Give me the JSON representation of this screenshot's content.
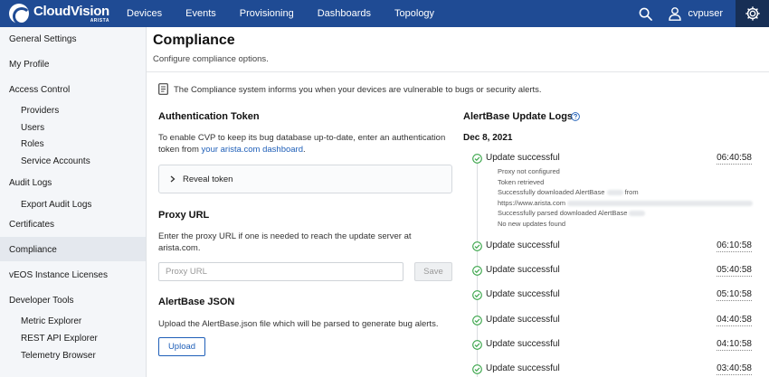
{
  "header": {
    "brand": "CloudVision",
    "brand_sub": "ARISTA",
    "nav": [
      "Devices",
      "Events",
      "Provisioning",
      "Dashboards",
      "Topology"
    ],
    "username": "cvpuser",
    "icons": {
      "search": "search-icon",
      "user": "user-icon",
      "settings": "gear-icon"
    },
    "colors": {
      "bar": "#1f4b94",
      "settings_bg": "#172f55"
    }
  },
  "sidebar": {
    "general_settings": "General Settings",
    "my_profile": "My Profile",
    "access_control": "Access Control",
    "providers": "Providers",
    "users": "Users",
    "roles": "Roles",
    "service_accounts": "Service Accounts",
    "audit_logs": "Audit Logs",
    "export_audit_logs": "Export Audit Logs",
    "certificates": "Certificates",
    "compliance": "Compliance",
    "veos_licenses": "vEOS Instance Licenses",
    "developer_tools": "Developer Tools",
    "metric_explorer": "Metric Explorer",
    "rest_api_explorer": "REST API Explorer",
    "telemetry_browser": "Telemetry Browser",
    "active": "Compliance"
  },
  "page": {
    "title": "Compliance",
    "subtitle": "Configure compliance options.",
    "info": "The Compliance system informs you when your devices are vulnerable to bugs or security alerts."
  },
  "auth": {
    "title": "Authentication Token",
    "desc_before": "To enable CVP to keep its bug database up-to-date, enter an authentication token from ",
    "desc_link": "your arista.com dashboard",
    "desc_after": ".",
    "reveal_label": "Reveal token"
  },
  "proxy": {
    "title": "Proxy URL",
    "desc": "Enter the proxy URL if one is needed to reach the update server at arista.com.",
    "placeholder": "Proxy URL",
    "save_label": "Save"
  },
  "alertbase": {
    "title": "AlertBase JSON",
    "desc": "Upload the AlertBase.json file which will be parsed to generate bug alerts.",
    "upload_label": "Upload"
  },
  "logs": {
    "title": "AlertBase Update Logs",
    "date": "Dec 8, 2021",
    "details": [
      "Proxy not configured",
      "Token retrieved",
      "Successfully downloaded AlertBase",
      "from",
      "https://www.arista.com",
      "Successfully parsed downloaded AlertBase",
      "No new updates found"
    ],
    "entries": [
      {
        "status": "Update successful",
        "time": "06:40:58"
      },
      {
        "status": "Update successful",
        "time": "06:10:58"
      },
      {
        "status": "Update successful",
        "time": "05:40:58"
      },
      {
        "status": "Update successful",
        "time": "05:10:58"
      },
      {
        "status": "Update successful",
        "time": "04:40:58"
      },
      {
        "status": "Update successful",
        "time": "04:10:58"
      },
      {
        "status": "Update successful",
        "time": "03:40:58"
      }
    ],
    "colors": {
      "success": "#3aa54a"
    }
  }
}
